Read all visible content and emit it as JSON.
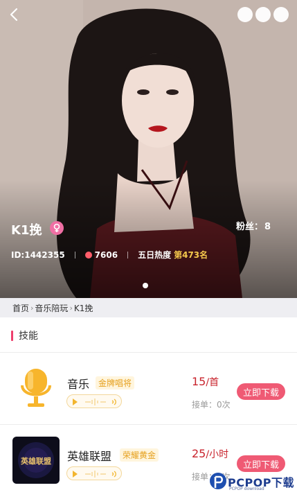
{
  "profile": {
    "name": "K1挽",
    "fans_label": "粉丝：",
    "fans_count": "8",
    "id_text": "ID:1442355",
    "heat_value": "7606",
    "heat_label": "五日热度",
    "rank_text": "第473名"
  },
  "breadcrumb": {
    "items": [
      "首页",
      "音乐陪玩",
      "K1挽"
    ],
    "separator": "›"
  },
  "skills_section": {
    "title": "技能",
    "items": [
      {
        "name": "音乐",
        "tag": "金牌唱将",
        "price": "15",
        "unit": "/首",
        "orders": "接单：0次",
        "button": "立即下载",
        "icon": "microphone-icon"
      },
      {
        "name": "英雄联盟",
        "tag": "荣耀黄金",
        "price": "25",
        "unit": "/小时",
        "orders": "接单：0次",
        "button": "立即下载",
        "icon": "league-of-legends-logo",
        "logo_text": "英雄联盟"
      }
    ]
  },
  "watermark": {
    "brand": "PCPOP下载",
    "sub": "PCPOP download"
  },
  "colors": {
    "accent_pink": "#ef5a74",
    "price_red": "#c8232c",
    "tag_gold": "#e6a11f",
    "rank_gold": "#f5c84c",
    "section_bar": "#ee3f6d"
  }
}
